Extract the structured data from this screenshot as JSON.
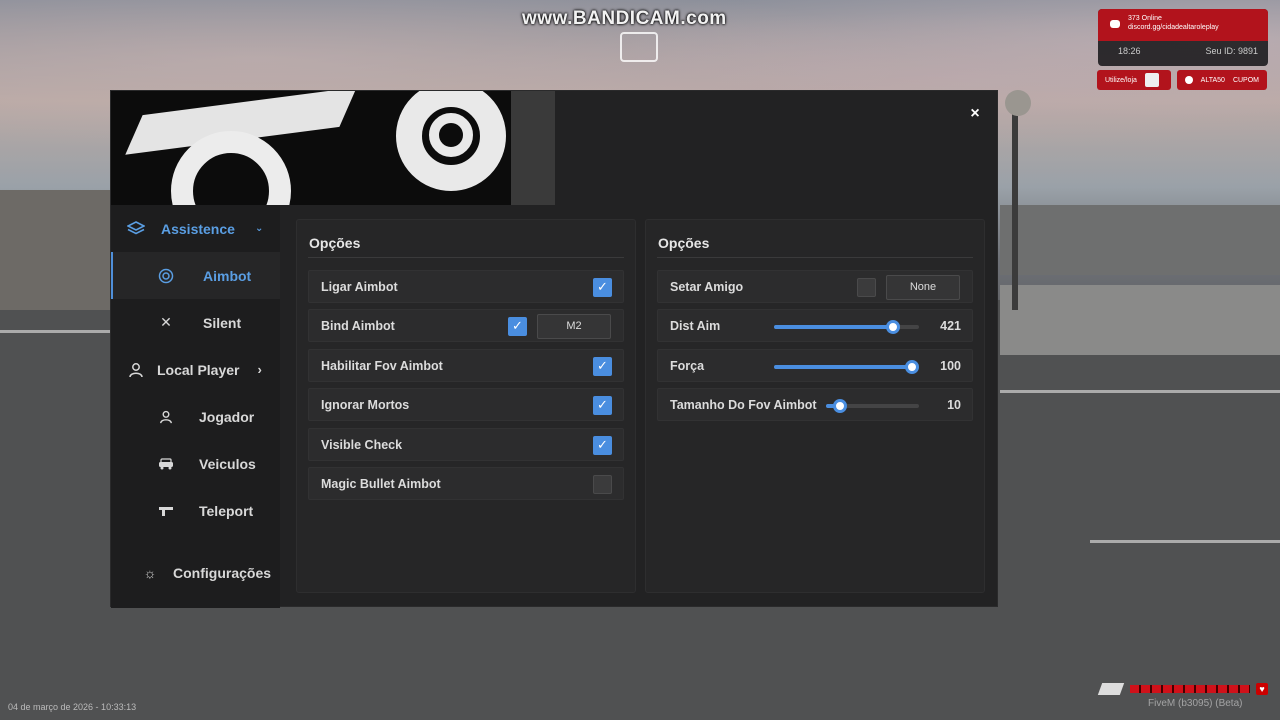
{
  "watermark": "www.BANDICAM.com",
  "server_widget": {
    "line1": "373 Online",
    "line2": "discord.gg/cidadealtaroleplay",
    "time": "18:26",
    "id_label": "Seu ID: 9891",
    "btn_store": "Utilize/loja",
    "btn_alta": "ALTA50",
    "btn_cupom": "CUPOM"
  },
  "menu": {
    "close_label": "×",
    "sidebar": {
      "cat_assistence": "Assistence",
      "sub_aimbot": "Aimbot",
      "sub_silent": "Silent",
      "cat_local_player": "Local Player",
      "sub_jogador": "Jogador",
      "sub_veiculos": "Veiculos",
      "sub_teleport": "Teleport",
      "settings": "Configurações"
    },
    "left_panel": {
      "title": "Opções",
      "rows": [
        {
          "label": "Ligar Aimbot",
          "checked": true
        },
        {
          "label": "Bind Aimbot",
          "checked": true,
          "key": "M2"
        },
        {
          "label": "Habilitar Fov Aimbot",
          "checked": true
        },
        {
          "label": "Ignorar Mortos",
          "checked": true
        },
        {
          "label": "Visible Check",
          "checked": true
        },
        {
          "label": "Magic Bullet Aimbot",
          "checked": false
        }
      ]
    },
    "right_panel": {
      "title": "Opções",
      "friend": {
        "label": "Setar Amigo",
        "checked": false,
        "key": "None"
      },
      "sliders": [
        {
          "label": "Dist Aim",
          "value": "421",
          "fraction": 0.82
        },
        {
          "label": "Força",
          "value": "100",
          "fraction": 1.0
        },
        {
          "label": "Tamanho Do Fov Aimbot",
          "value": "10",
          "fraction": 0.15
        }
      ]
    }
  },
  "footer_timestamp": "04 de março de 2026 - 10:33:13",
  "fivem_label": "FiveM (b3095) (Beta)",
  "colors": {
    "accent": "#4a8ee0",
    "panel": "#262627",
    "server_red": "#b2131c"
  }
}
